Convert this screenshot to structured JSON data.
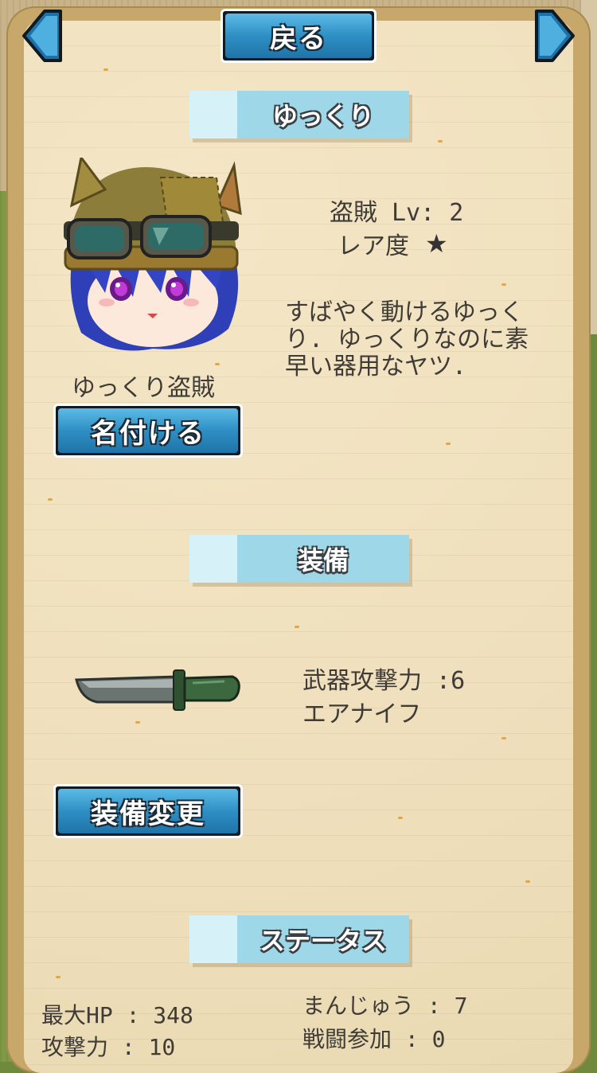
{
  "nav": {
    "back_label": "戻る",
    "prev_icon": "left-arrow-icon",
    "next_icon": "right-arrow-icon"
  },
  "character_section": {
    "header": "ゆっくり",
    "class_level": "盗賊 Lv: 2",
    "rarity_label": "レア度",
    "rarity_stars": 1,
    "description_lines": [
      "すばやく動けるゆっく",
      "り. ゆっくりなのに素",
      "早い器用なヤツ."
    ],
    "name": "ゆっくり盗賊",
    "rename_button": "名付ける"
  },
  "equipment_section": {
    "header": "装備",
    "weapon_attack": "武器攻撃力 :6",
    "weapon_name": "エアナイフ",
    "change_button": "装備変更"
  },
  "status_section": {
    "header": "ステータス",
    "max_hp": "最大HP : 348",
    "attack": "攻撃力 : 10",
    "manju": "まんじゅう : 7",
    "battles": "戦闘参加 : 0"
  },
  "colors": {
    "button_blue": "#2e8fc4",
    "header_blue": "#9ed8e8",
    "paper": "#efdfbc",
    "text": "#3f3b36"
  }
}
